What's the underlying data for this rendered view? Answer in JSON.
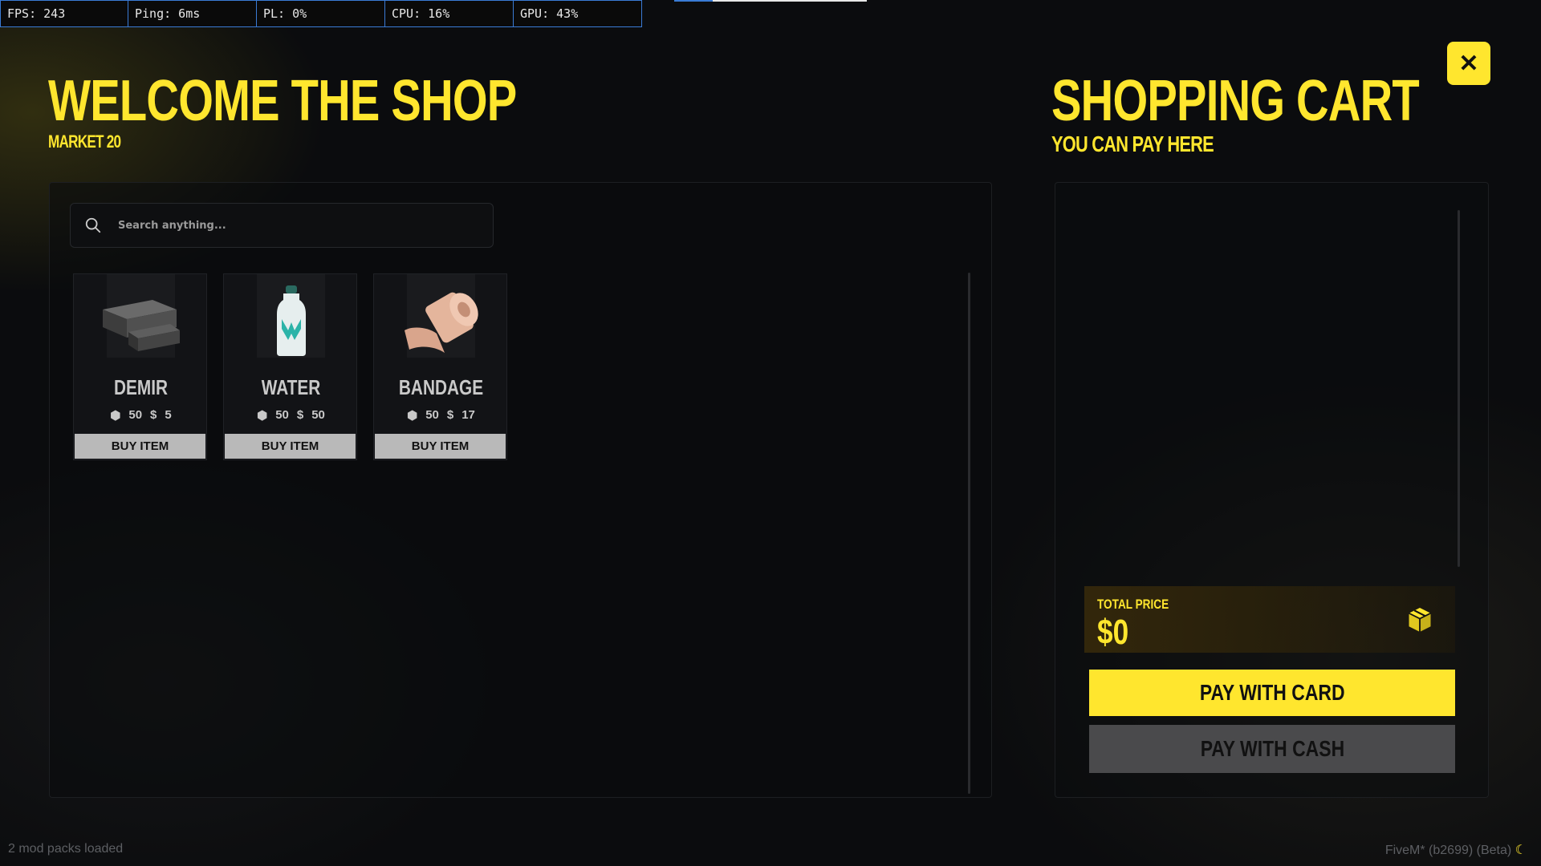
{
  "perf": {
    "fps": "FPS: 243",
    "ping": "Ping: 6ms",
    "pl": "PL: 0%",
    "cpu": "CPU: 16%",
    "gpu": "GPU: 43%"
  },
  "shop": {
    "title": "WELCOME THE SHOP",
    "subtitle": "MARKET 20",
    "search_placeholder": "Search anything...",
    "items": [
      {
        "name": "DEMIR",
        "stock": "50",
        "price": "5",
        "buy_label": "BUY ITEM",
        "icon": "iron-bars-icon"
      },
      {
        "name": "WATER",
        "stock": "50",
        "price": "50",
        "buy_label": "BUY ITEM",
        "icon": "water-bottle-icon"
      },
      {
        "name": "BANDAGE",
        "stock": "50",
        "price": "17",
        "buy_label": "BUY ITEM",
        "icon": "bandage-roll-icon"
      }
    ]
  },
  "cart": {
    "title": "SHOPPING CART",
    "subtitle": "YOU CAN PAY HERE",
    "total_label": "TOTAL PRICE",
    "total_value": "$0",
    "pay_card_label": "PAY WITH CARD",
    "pay_cash_label": "PAY WITH CASH"
  },
  "close_label": "✕",
  "footer": {
    "left": "2 mod packs loaded",
    "right": "FiveM* (b2699) (Beta)"
  },
  "colors": {
    "accent": "#ffe62e",
    "background": "#0b0c0e",
    "button_gray": "#b9b9b9"
  }
}
